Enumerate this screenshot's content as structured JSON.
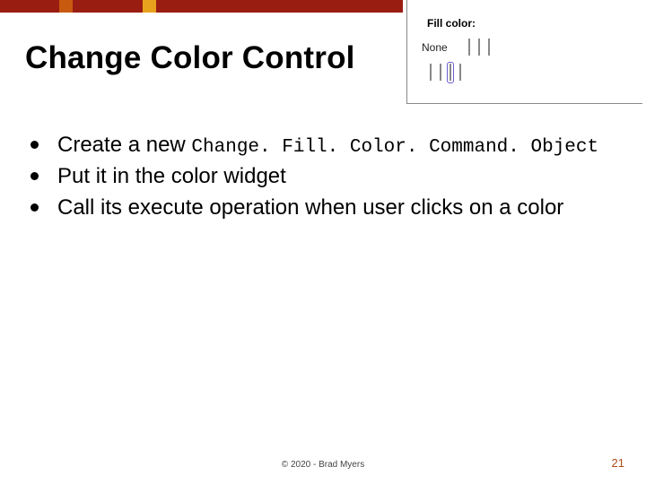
{
  "title": "Change Color Control",
  "widget": {
    "label": "Fill color:",
    "none_label": "None",
    "swatches_row1": [
      {
        "name": "swatch-white",
        "color": "#ffffff",
        "selected": false
      },
      {
        "name": "swatch-gray",
        "color": "#b5b5b5",
        "selected": false
      },
      {
        "name": "swatch-black",
        "color": "#000000",
        "selected": false
      }
    ],
    "swatches_row2": [
      {
        "name": "swatch-yellow",
        "color": "#f4de4d",
        "selected": false
      },
      {
        "name": "swatch-red",
        "color": "#c7522d",
        "selected": false
      },
      {
        "name": "swatch-blue",
        "color": "#7aa6d9",
        "selected": true
      },
      {
        "name": "swatch-green",
        "color": "#a4c15b",
        "selected": false
      }
    ]
  },
  "bullets": [
    {
      "pre": "Create a new ",
      "code": "Change. Fill. Color. Command. Object",
      "post": ""
    },
    {
      "pre": "Put it in the color widget",
      "code": "",
      "post": ""
    },
    {
      "pre": "Call its execute operation when user clicks on a color",
      "code": "",
      "post": ""
    }
  ],
  "footer": {
    "copyright": "© 2020 - Brad Myers",
    "page_number": "21"
  }
}
